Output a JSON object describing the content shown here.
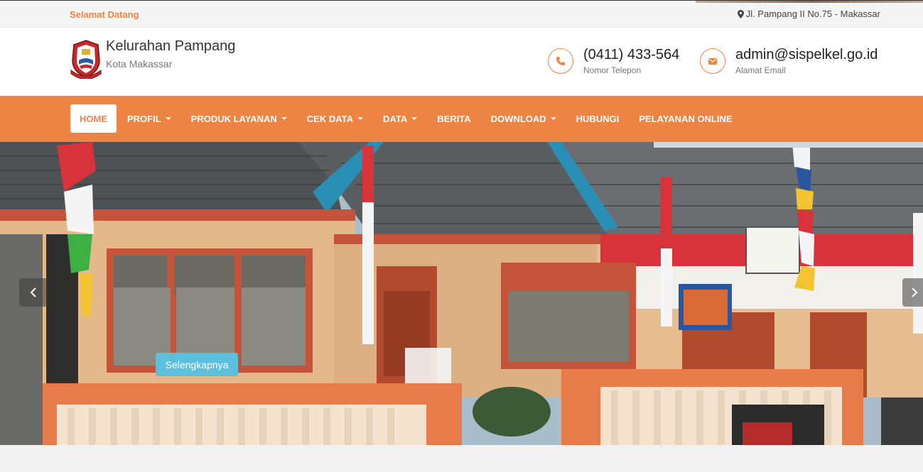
{
  "topbar": {
    "welcome": "Selamat Datang",
    "address": "Jl. Pampang II No.75 - Makassar"
  },
  "header": {
    "site_title": "Kelurahan Pampang",
    "site_subtitle": "Kota Makassar",
    "phone": {
      "value": "(0411) 433-564",
      "label": "Nomor Telepon"
    },
    "email": {
      "value": "admin@sispelkel.go.id",
      "label": "Alamat Email"
    }
  },
  "nav": {
    "items": [
      {
        "label": "HOME"
      },
      {
        "label": "PROFIL"
      },
      {
        "label": "PRODUK LAYANAN"
      },
      {
        "label": "CEK DATA"
      },
      {
        "label": "DATA"
      },
      {
        "label": "BERITA"
      },
      {
        "label": "DOWNLOAD"
      },
      {
        "label": "HUBUNGI"
      },
      {
        "label": "PELAYANAN ONLINE"
      }
    ]
  },
  "slider": {
    "button_label": "Selengkapnya"
  },
  "colors": {
    "accent": "#ee8444",
    "button_info": "#5bc0de"
  }
}
